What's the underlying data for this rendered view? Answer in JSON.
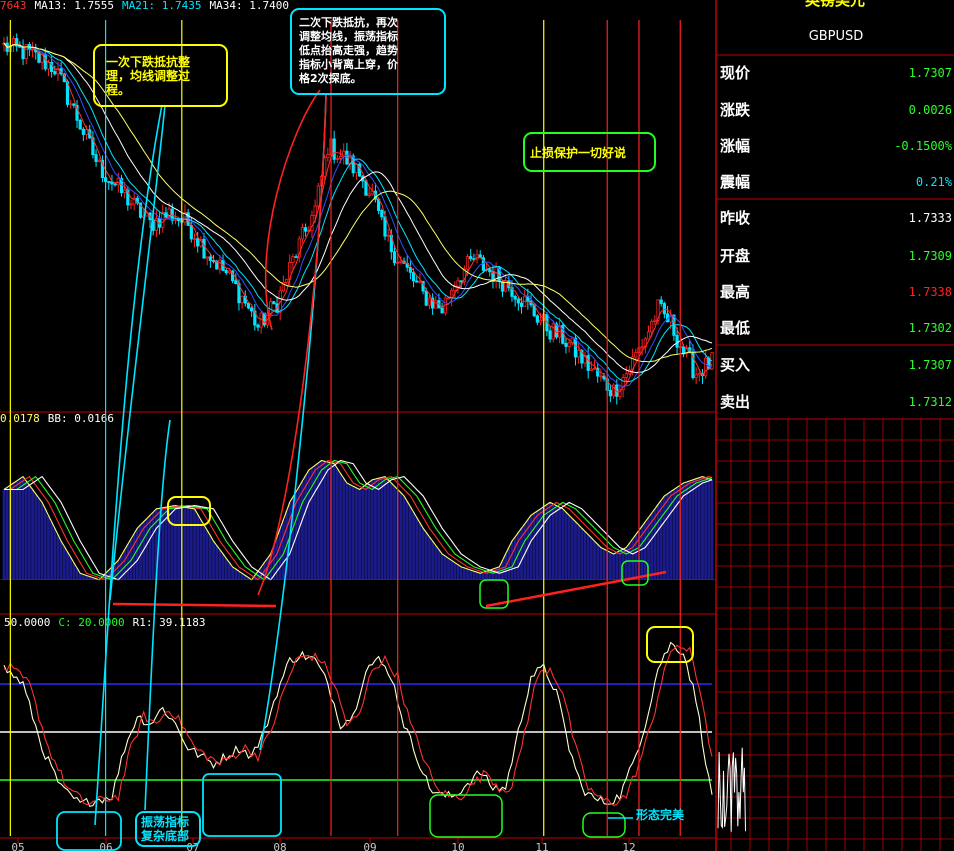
{
  "app": {
    "symbol": "GBPUSD",
    "title": "英镑美元"
  },
  "colors": {
    "background": "#000000",
    "grid": "#c00000",
    "up": "#ff2020",
    "down": "#00e5ff",
    "ma5": "#ff3030",
    "ma13": "#3050ff",
    "ma21": "#00e5ff",
    "ma34": "#ffffff",
    "ma55": "#ffff66",
    "fill": "#1b1b8a",
    "k_line": "#ffffcc",
    "d_line": "#ff3030",
    "level_high": "#2b2bff",
    "level_mid": "#ffffff",
    "level_low": "#20ff20",
    "quote_green": "#2bff2b",
    "quote_red": "#ff2020",
    "quote_cyan": "#00e5ff",
    "yellow": "#ffff00",
    "cyan": "#00e5ff",
    "green": "#20ff20"
  },
  "legend": {
    "price": [
      {
        "text": "7643",
        "color": "#ff3030"
      },
      {
        "text": "MA13: 1.7555",
        "color": "#ffffff"
      },
      {
        "text": "MA21: 1.7435",
        "color": "#00e5ff"
      },
      {
        "text": "MA34: 1.7400",
        "color": "#ffffff"
      }
    ],
    "macd": [
      {
        "text": "0.0178",
        "color": "#ffff66"
      },
      {
        "text": "BB: 0.0166",
        "color": "#ffffff"
      }
    ],
    "osc": [
      {
        "text": "50.0000",
        "color": "#ffffff"
      },
      {
        "text": "C: 20.0000",
        "color": "#20ff20"
      },
      {
        "text": "R1: 39.1183",
        "color": "#ffffff"
      }
    ]
  },
  "quote": {
    "rows": [
      {
        "label": "现价",
        "value": "1.7307",
        "color": "#2bff2b"
      },
      {
        "label": "涨跌",
        "value": "0.0026",
        "color": "#2bff2b"
      },
      {
        "label": "涨幅",
        "value": "-0.1500%",
        "color": "#2bff2b"
      },
      {
        "label": "震幅",
        "value": "0.21%",
        "color": "#00e5ff"
      },
      {
        "label": "昨收",
        "value": "1.7333",
        "color": "#ffffff"
      },
      {
        "label": "开盘",
        "value": "1.7309",
        "color": "#2bff2b"
      },
      {
        "label": "最高",
        "value": "1.7338",
        "color": "#ff2020"
      },
      {
        "label": "最低",
        "value": "1.7302",
        "color": "#2bff2b"
      },
      {
        "label": "买入",
        "value": "1.7307",
        "color": "#2bff2b"
      },
      {
        "label": "卖出",
        "value": "1.7312",
        "color": "#2bff2b"
      }
    ]
  },
  "annotations": [
    {
      "id": "a1",
      "lines": [
        "一次下跌抵抗整",
        "理，均线调整过",
        "程。"
      ],
      "color": "#ffff00",
      "box": "#ffff00"
    },
    {
      "id": "a2",
      "lines": [
        "二次下跌抵抗，再次",
        "调整均线，振荡指标",
        "低点抬高走强，趋势",
        "指标小背离上穿，价",
        "格2次探底。"
      ],
      "color": "#ffffff",
      "box": "#00e5ff"
    },
    {
      "id": "a3",
      "lines": [
        "止损保护一切好说"
      ],
      "color": "#ffff00",
      "box": "#20ff20"
    },
    {
      "id": "a4",
      "lines": [
        "振荡指标",
        "复杂底部"
      ],
      "color": "#00e5ff",
      "box": "#00e5ff"
    },
    {
      "id": "a5",
      "lines": [
        "形态完美"
      ],
      "color": "#00e5ff",
      "box": "none"
    }
  ],
  "chart_data": {
    "type": "line",
    "title": "",
    "xlabel": "",
    "ylabel": "",
    "x_ticks": [
      "05",
      "06",
      "07",
      "08",
      "09",
      "10",
      "11",
      "12"
    ],
    "price": {
      "type": "candlestick",
      "ylim": [
        1.7285,
        1.783
      ],
      "series": [
        {
          "name": "MA13",
          "value": 1.7555
        },
        {
          "name": "MA21",
          "value": 1.7435
        },
        {
          "name": "MA34",
          "value": 1.74
        }
      ],
      "close_path": [
        [
          0,
          1.779
        ],
        [
          8,
          1.778
        ],
        [
          16,
          1.776
        ],
        [
          22,
          1.77
        ],
        [
          30,
          1.762
        ],
        [
          38,
          1.758
        ],
        [
          46,
          1.754
        ],
        [
          52,
          1.7555
        ],
        [
          58,
          1.754
        ],
        [
          64,
          1.75
        ],
        [
          70,
          1.747
        ],
        [
          76,
          1.743
        ],
        [
          80,
          1.7395
        ],
        [
          86,
          1.743
        ],
        [
          92,
          1.75
        ],
        [
          98,
          1.756
        ],
        [
          102,
          1.765
        ],
        [
          108,
          1.763
        ],
        [
          112,
          1.761
        ],
        [
          116,
          1.758
        ],
        [
          120,
          1.752
        ],
        [
          126,
          1.748
        ],
        [
          132,
          1.744
        ],
        [
          138,
          1.742
        ],
        [
          142,
          1.746
        ],
        [
          148,
          1.749
        ],
        [
          154,
          1.747
        ],
        [
          160,
          1.745
        ],
        [
          166,
          1.742
        ],
        [
          172,
          1.739
        ],
        [
          176,
          1.738
        ],
        [
          182,
          1.735
        ],
        [
          188,
          1.732
        ],
        [
          192,
          1.7305
        ],
        [
          196,
          1.733
        ],
        [
          202,
          1.738
        ],
        [
          206,
          1.742
        ],
        [
          210,
          1.74
        ],
        [
          214,
          1.736
        ],
        [
          218,
          1.733
        ],
        [
          223,
          1.7345
        ]
      ],
      "ma_offsets": {
        "MA5": 1,
        "MA13": 3,
        "MA21": 5,
        "MA34": 9,
        "MA55": 14
      }
    },
    "macd": {
      "type": "area",
      "ylim": [
        -0.005,
        0.024
      ],
      "series": [
        {
          "name": "BB",
          "value": 0.0166
        }
      ],
      "path": [
        [
          0,
          0.014
        ],
        [
          6,
          0.016
        ],
        [
          12,
          0.012
        ],
        [
          18,
          0.006
        ],
        [
          24,
          0.001
        ],
        [
          30,
          0.0
        ],
        [
          36,
          0.003
        ],
        [
          42,
          0.008
        ],
        [
          48,
          0.011
        ],
        [
          54,
          0.0115
        ],
        [
          60,
          0.011
        ],
        [
          66,
          0.006
        ],
        [
          72,
          0.002
        ],
        [
          78,
          0.0
        ],
        [
          84,
          0.004
        ],
        [
          90,
          0.012
        ],
        [
          96,
          0.017
        ],
        [
          100,
          0.0185
        ],
        [
          104,
          0.018
        ],
        [
          108,
          0.015
        ],
        [
          112,
          0.014
        ],
        [
          116,
          0.0155
        ],
        [
          120,
          0.016
        ],
        [
          126,
          0.013
        ],
        [
          132,
          0.008
        ],
        [
          138,
          0.004
        ],
        [
          144,
          0.002
        ],
        [
          150,
          0.001
        ],
        [
          156,
          0.002
        ],
        [
          160,
          0.006
        ],
        [
          166,
          0.01
        ],
        [
          172,
          0.012
        ],
        [
          176,
          0.011
        ],
        [
          182,
          0.008
        ],
        [
          188,
          0.005
        ],
        [
          192,
          0.004
        ],
        [
          196,
          0.005
        ],
        [
          202,
          0.009
        ],
        [
          208,
          0.013
        ],
        [
          214,
          0.015
        ],
        [
          220,
          0.016
        ],
        [
          223,
          0.0155
        ]
      ]
    },
    "oscillator": {
      "type": "line",
      "ylim": [
        -15,
        115
      ],
      "levels": [
        {
          "name": "A",
          "value": 80
        },
        {
          "name": "B",
          "value": 50
        },
        {
          "name": "C",
          "value": 20
        }
      ],
      "series": [
        {
          "name": "R1",
          "value": 39.1183
        }
      ],
      "path": [
        [
          0,
          90
        ],
        [
          6,
          80
        ],
        [
          12,
          40
        ],
        [
          18,
          15
        ],
        [
          24,
          5
        ],
        [
          30,
          8
        ],
        [
          34,
          10
        ],
        [
          38,
          40
        ],
        [
          42,
          60
        ],
        [
          46,
          55
        ],
        [
          50,
          65
        ],
        [
          54,
          55
        ],
        [
          58,
          40
        ],
        [
          62,
          35
        ],
        [
          66,
          30
        ],
        [
          70,
          35
        ],
        [
          74,
          40
        ],
        [
          78,
          35
        ],
        [
          82,
          50
        ],
        [
          86,
          75
        ],
        [
          90,
          95
        ],
        [
          94,
          98
        ],
        [
          98,
          95
        ],
        [
          102,
          80
        ],
        [
          106,
          55
        ],
        [
          110,
          60
        ],
        [
          114,
          90
        ],
        [
          118,
          95
        ],
        [
          122,
          85
        ],
        [
          126,
          55
        ],
        [
          130,
          35
        ],
        [
          134,
          15
        ],
        [
          138,
          10
        ],
        [
          142,
          10
        ],
        [
          146,
          18
        ],
        [
          150,
          25
        ],
        [
          154,
          15
        ],
        [
          158,
          15
        ],
        [
          162,
          50
        ],
        [
          166,
          85
        ],
        [
          170,
          90
        ],
        [
          174,
          75
        ],
        [
          178,
          40
        ],
        [
          182,
          15
        ],
        [
          186,
          8
        ],
        [
          190,
          6
        ],
        [
          194,
          10
        ],
        [
          198,
          30
        ],
        [
          202,
          55
        ],
        [
          206,
          90
        ],
        [
          210,
          105
        ],
        [
          214,
          100
        ],
        [
          218,
          70
        ],
        [
          222,
          20
        ],
        [
          223,
          10
        ]
      ]
    },
    "vertical_markers": [
      {
        "x": 2,
        "color": "#ffff00"
      },
      {
        "x": 32,
        "color": "#00e5ff"
      },
      {
        "x": 56,
        "color": "#ffff00"
      },
      {
        "x": 103,
        "color": "#ff2020"
      },
      {
        "x": 124,
        "color": "#ff2020"
      },
      {
        "x": 170,
        "color": "#ffff00"
      },
      {
        "x": 190,
        "color": "#ff2020"
      },
      {
        "x": 200,
        "color": "#ff2020"
      },
      {
        "x": 213,
        "color": "#ff2020"
      }
    ]
  }
}
